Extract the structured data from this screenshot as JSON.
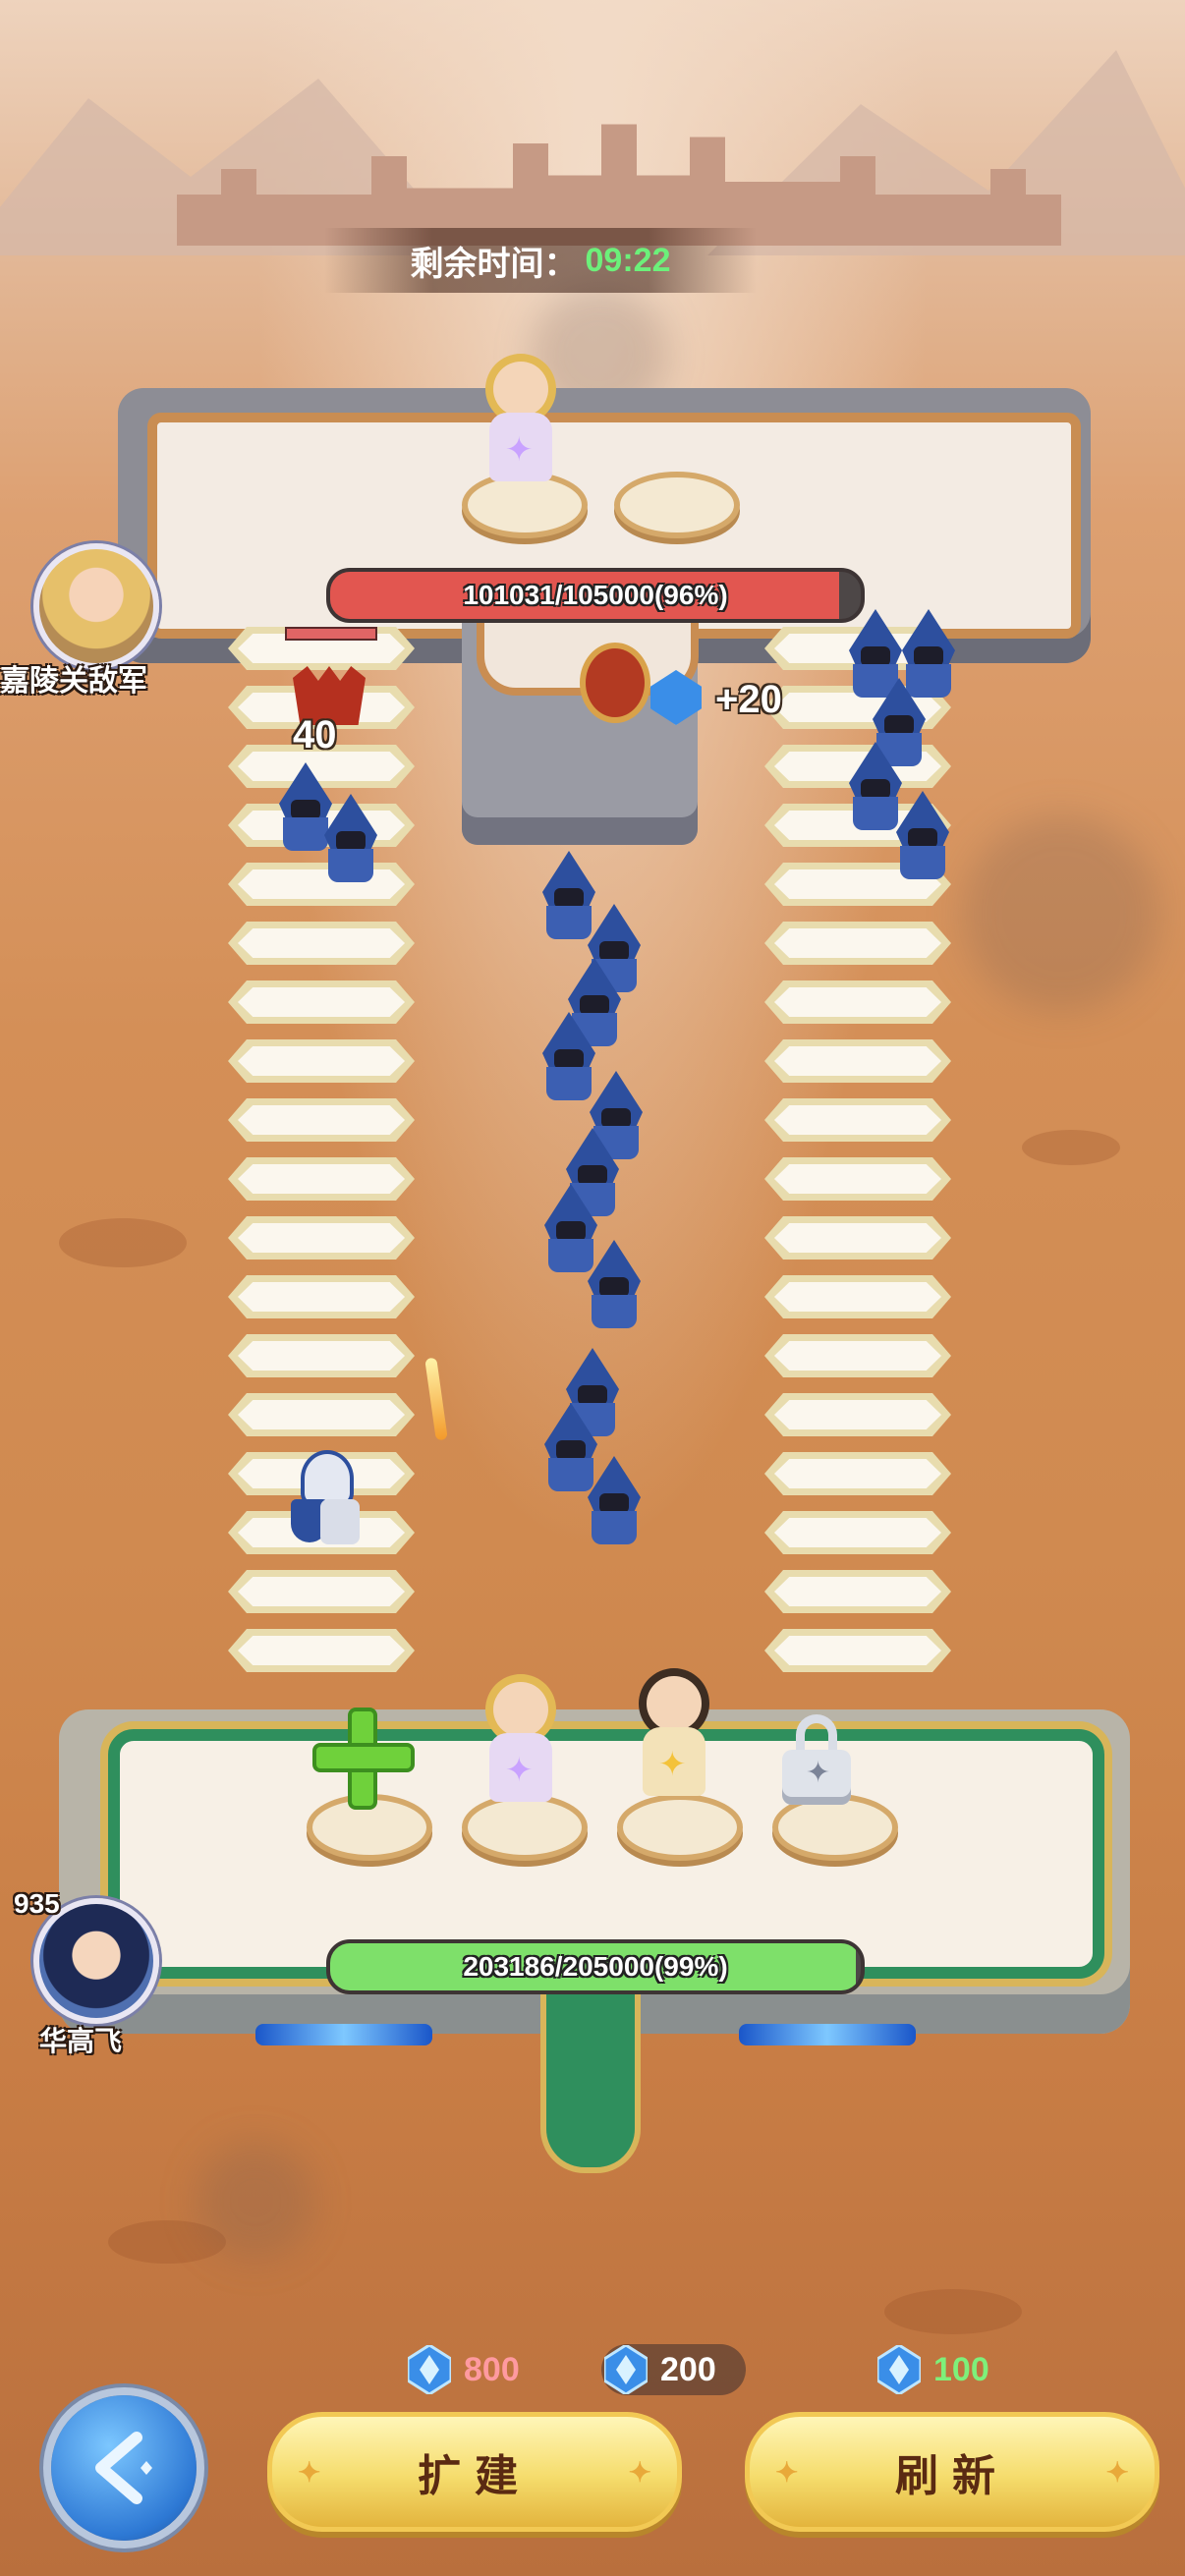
{
  "timer": {
    "label": "剩余时间：",
    "value": "09:22"
  },
  "enemy": {
    "name": "嘉陵关敌军",
    "hp_text": "101031/105000(96%)",
    "hp_fraction": 0.96,
    "hp_color": "#e25650",
    "reward_text": "+20",
    "damage_text": "40"
  },
  "player": {
    "name": "华高飞",
    "level": "935",
    "hp_text": "203186/205000(99%)",
    "hp_fraction": 0.99,
    "hp_color": "#7ee06a"
  },
  "resources": [
    {
      "icon": "crystal-icon",
      "value": "800",
      "color": "#ff9aa0"
    },
    {
      "icon": "crystal-icon",
      "value": "200",
      "color": "#ffffff"
    },
    {
      "icon": "crystal-icon",
      "value": "100",
      "color": "#7ef07a"
    }
  ],
  "buttons": {
    "expand": "扩建",
    "refresh": "刷新"
  },
  "icons": {
    "add_slot": "plus-icon",
    "locked_slot": "lock-icon",
    "back": "back-arrow-icon"
  }
}
